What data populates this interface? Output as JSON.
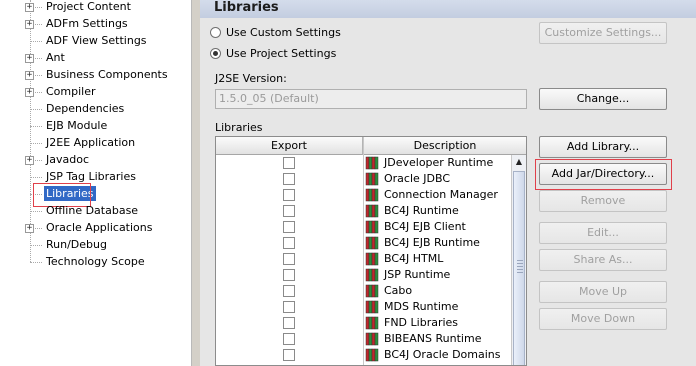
{
  "tree": {
    "items": [
      {
        "label": "Project Content",
        "expandable": true,
        "selected": false
      },
      {
        "label": "ADFm Settings",
        "expandable": true,
        "selected": false
      },
      {
        "label": "ADF View Settings",
        "expandable": false,
        "selected": false
      },
      {
        "label": "Ant",
        "expandable": true,
        "selected": false
      },
      {
        "label": "Business Components",
        "expandable": true,
        "selected": false
      },
      {
        "label": "Compiler",
        "expandable": true,
        "selected": false
      },
      {
        "label": "Dependencies",
        "expandable": false,
        "selected": false
      },
      {
        "label": "EJB Module",
        "expandable": false,
        "selected": false
      },
      {
        "label": "J2EE Application",
        "expandable": false,
        "selected": false
      },
      {
        "label": "Javadoc",
        "expandable": true,
        "selected": false
      },
      {
        "label": "JSP Tag Libraries",
        "expandable": false,
        "selected": false
      },
      {
        "label": "Libraries",
        "expandable": false,
        "selected": true
      },
      {
        "label": "Offline Database",
        "expandable": false,
        "selected": false
      },
      {
        "label": "Oracle Applications",
        "expandable": true,
        "selected": false
      },
      {
        "label": "Run/Debug",
        "expandable": false,
        "selected": false
      },
      {
        "label": "Technology Scope",
        "expandable": false,
        "selected": false
      }
    ],
    "expander_glyph": "+"
  },
  "panel": {
    "title": "Libraries",
    "radio_custom": "Use Custom Settings",
    "radio_project": "Use Project Settings",
    "selected_radio": "project",
    "customize_button": "Customize Settings...",
    "j2se_label": "J2SE Version:",
    "j2se_value": "1.5.0_05 (Default)",
    "change_button": "Change...",
    "libraries_label": "Libraries",
    "buttons": {
      "add_library": "Add Library...",
      "add_jar": "Add Jar/Directory...",
      "remove": "Remove",
      "edit": "Edit...",
      "share_as": "Share As...",
      "move_up": "Move Up",
      "move_down": "Move Down"
    }
  },
  "table": {
    "columns": [
      "Export",
      "Description"
    ],
    "rows": [
      {
        "export": false,
        "description": "JDeveloper Runtime"
      },
      {
        "export": false,
        "description": "Oracle JDBC"
      },
      {
        "export": false,
        "description": "Connection Manager"
      },
      {
        "export": false,
        "description": "BC4J Runtime"
      },
      {
        "export": false,
        "description": "BC4J EJB Client"
      },
      {
        "export": false,
        "description": "BC4J EJB Runtime"
      },
      {
        "export": false,
        "description": "BC4J HTML"
      },
      {
        "export": false,
        "description": "JSP Runtime"
      },
      {
        "export": false,
        "description": "Cabo"
      },
      {
        "export": false,
        "description": "MDS Runtime"
      },
      {
        "export": false,
        "description": "FND Libraries"
      },
      {
        "export": false,
        "description": "BIBEANS Runtime"
      },
      {
        "export": false,
        "description": "BC4J Oracle Domains"
      }
    ],
    "scroll_up_glyph": "▲"
  },
  "colors": {
    "selection": "#3169c6",
    "highlight_box": "#e0404a",
    "jar_red": "#c0282c",
    "jar_green": "#2c8f3c"
  }
}
